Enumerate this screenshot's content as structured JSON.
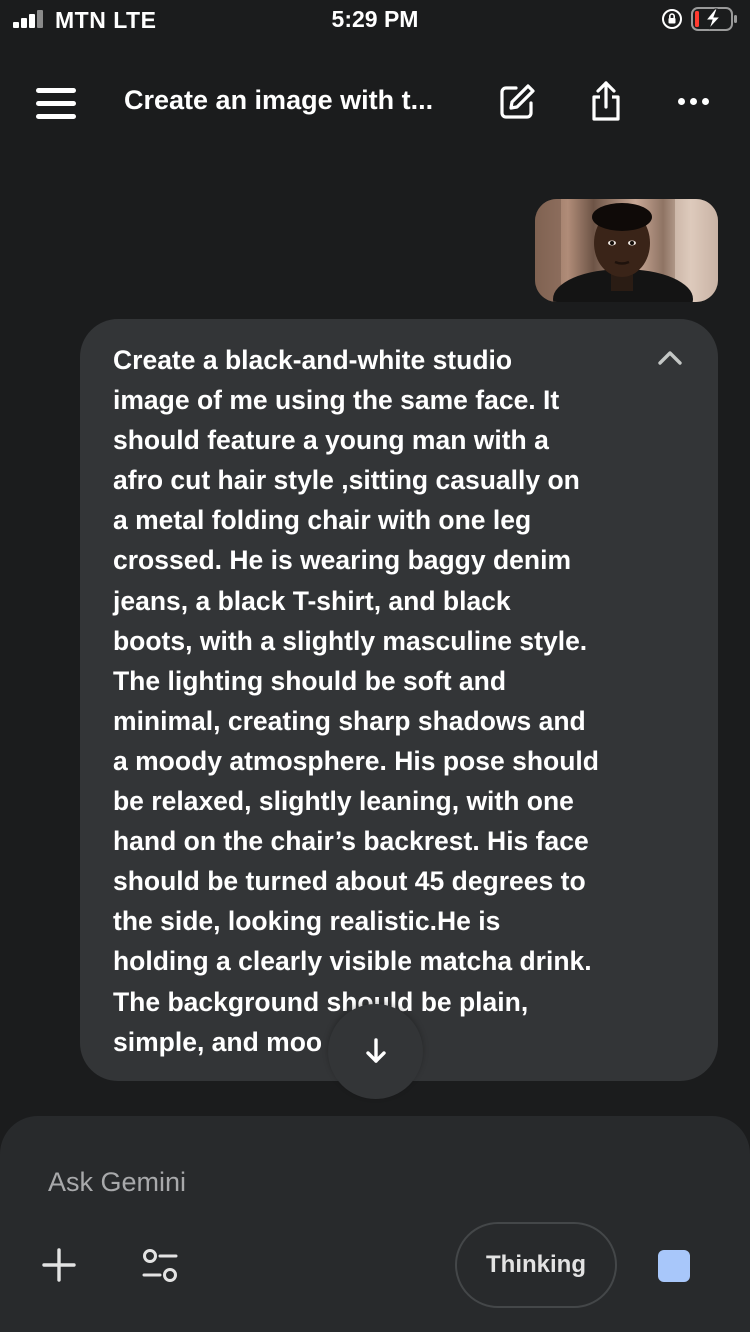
{
  "status_bar": {
    "carrier": "MTN  LTE",
    "time": "5:29 PM"
  },
  "header": {
    "title": "Create an image with t..."
  },
  "prompt": {
    "lines": [
      "Create a black-and-white studio",
      "image of me using the same face. It",
      "should feature a young man with a",
      "afro cut hair style ,sitting casually on",
      "a metal folding chair with one leg",
      "crossed. He is wearing baggy denim",
      "jeans, a black T-shirt, and black",
      "boots, with a slightly masculine style.",
      "The lighting should be soft and",
      "minimal, creating sharp shadows and",
      "a moody atmosphere. His pose should",
      "be relaxed, slightly leaning, with one",
      "hand on the chair’s backrest. His face",
      "should be turned about 45 degrees to",
      "the side, looking realistic.He is",
      "holding a clearly visible matcha drink.",
      "The background should be plain,",
      "simple, and moo"
    ]
  },
  "composer": {
    "placeholder": "Ask Gemini",
    "thinking_label": "Thinking"
  },
  "icons": {
    "menu": "hamburger-menu-icon",
    "edit": "edit-icon",
    "share": "share-icon",
    "more": "more-icon",
    "collapse": "chevron-up-icon",
    "scroll": "arrow-down-icon",
    "add": "plus-icon",
    "tools": "tools-icon",
    "stop": "stop-icon"
  },
  "colors": {
    "background": "#1b1c1d",
    "bubble": "#333537",
    "composer": "#282a2c",
    "accent": "#a8c7fa"
  }
}
